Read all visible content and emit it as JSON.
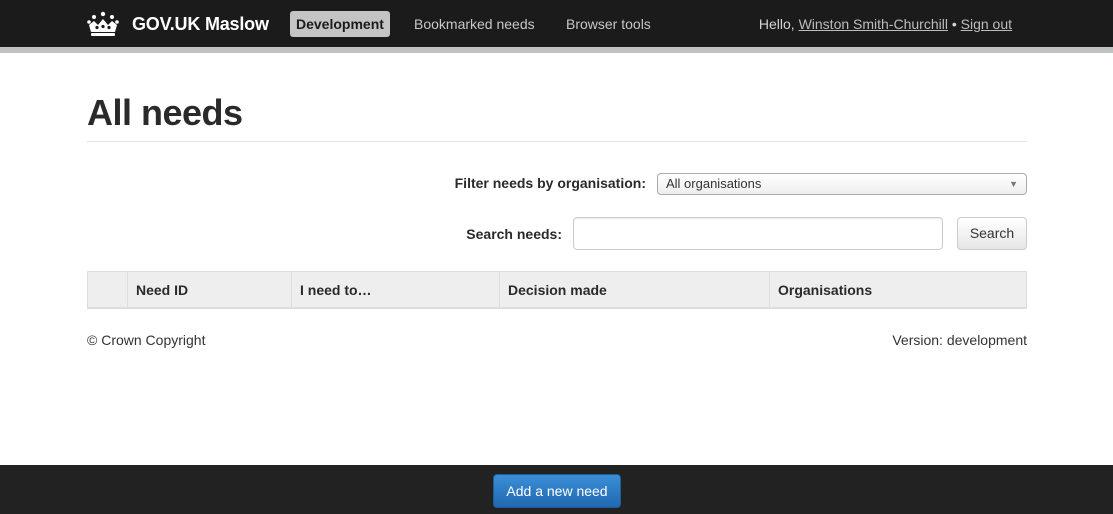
{
  "navbar": {
    "brand": "GOV.UK Maslow",
    "brand_icon": "crown-icon",
    "environment_label": "Development",
    "links": [
      "Bookmarked needs",
      "Browser tools"
    ],
    "greeting": "Hello, ",
    "user_name": "Winston Smith-Churchill",
    "separator": " • ",
    "sign_out": "Sign out"
  },
  "page": {
    "title": "All needs"
  },
  "filter": {
    "label": "Filter needs by organisation:",
    "selected": "All organisations",
    "arrow_icon": "chevron-down-icon"
  },
  "search": {
    "label": "Search needs:",
    "value": "",
    "placeholder": "",
    "button_label": "Search"
  },
  "table": {
    "columns": [
      "",
      "Need ID",
      "I need to…",
      "Decision made",
      "Organisations"
    ],
    "rows": []
  },
  "footer": {
    "copyright": "© Crown Copyright",
    "version": "Version: development"
  },
  "actions": {
    "add_need_label": "Add a new need"
  },
  "colors": {
    "navbar_bg": "#1b1b1b",
    "primary_button": "#2a7bc3",
    "footer_bg": "#222222"
  }
}
